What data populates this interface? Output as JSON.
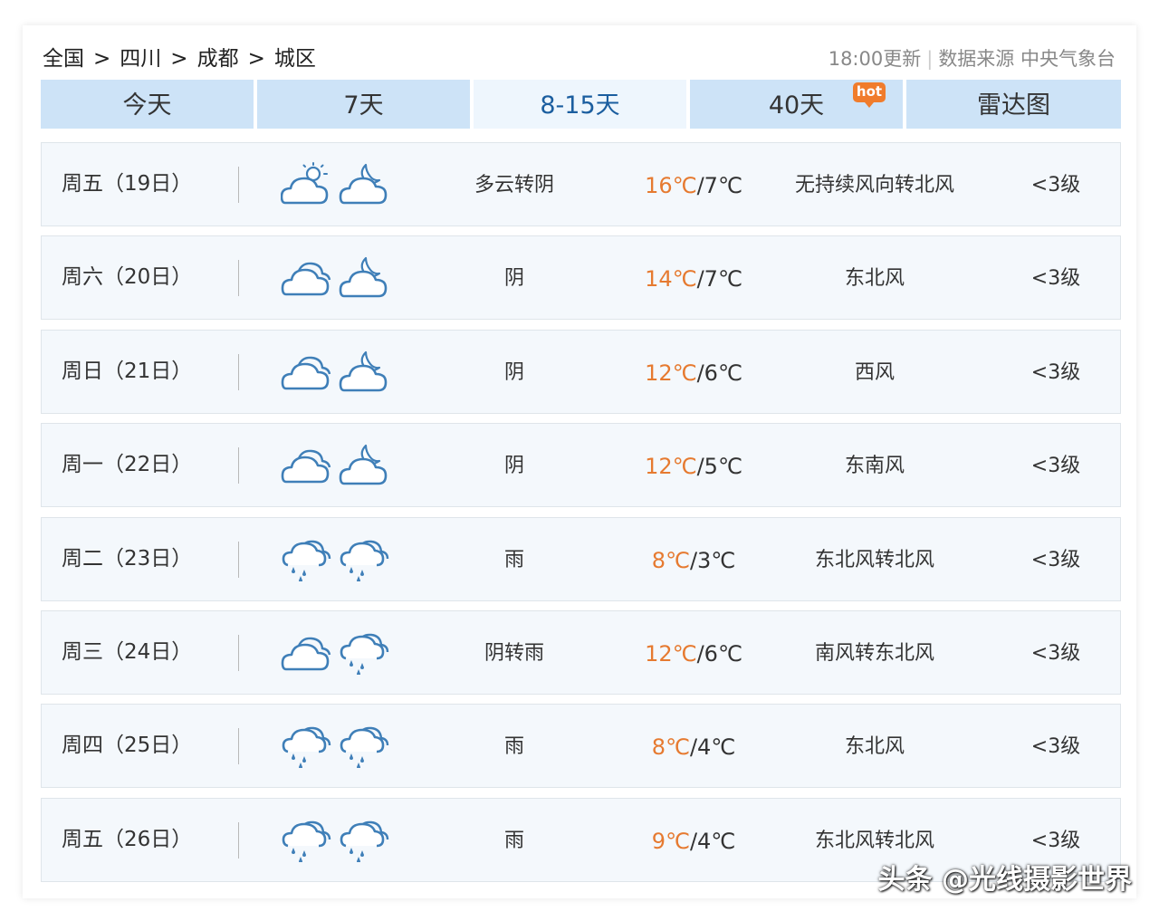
{
  "breadcrumb": [
    "全国",
    "四川",
    "成都",
    "城区"
  ],
  "breadcrumb_separator": ">",
  "update_time": "18:00更新",
  "data_source": "数据来源 中央气象台",
  "tabs": [
    {
      "label": "今天"
    },
    {
      "label": "7天"
    },
    {
      "label": "8-15天",
      "active": true
    },
    {
      "label": "40天",
      "badge": "hot"
    },
    {
      "label": "雷达图"
    }
  ],
  "forecast": [
    {
      "day": "周五（19日）",
      "icons": [
        "partly-cloudy-day-icon",
        "cloudy-night-icon"
      ],
      "weather": "多云转阴",
      "high": "16℃",
      "low": "/7℃",
      "wind": "无持续风向转北风",
      "level": "<3级"
    },
    {
      "day": "周六（20日）",
      "icons": [
        "cloudy-icon",
        "cloudy-night-icon"
      ],
      "weather": "阴",
      "high": "14℃",
      "low": "/7℃",
      "wind": "东北风",
      "level": "<3级"
    },
    {
      "day": "周日（21日）",
      "icons": [
        "cloudy-icon",
        "cloudy-night-icon"
      ],
      "weather": "阴",
      "high": "12℃",
      "low": "/6℃",
      "wind": "西风",
      "level": "<3级"
    },
    {
      "day": "周一（22日）",
      "icons": [
        "cloudy-icon",
        "cloudy-night-icon"
      ],
      "weather": "阴",
      "high": "12℃",
      "low": "/5℃",
      "wind": "东南风",
      "level": "<3级"
    },
    {
      "day": "周二（23日）",
      "icons": [
        "rain-icon",
        "rain-icon"
      ],
      "weather": "雨",
      "high": "8℃",
      "low": "/3℃",
      "wind": "东北风转北风",
      "level": "<3级"
    },
    {
      "day": "周三（24日）",
      "icons": [
        "cloudy-icon",
        "rain-icon"
      ],
      "weather": "阴转雨",
      "high": "12℃",
      "low": "/6℃",
      "wind": "南风转东北风",
      "level": "<3级"
    },
    {
      "day": "周四（25日）",
      "icons": [
        "rain-icon",
        "rain-icon"
      ],
      "weather": "雨",
      "high": "8℃",
      "low": "/4℃",
      "wind": "东北风",
      "level": "<3级"
    },
    {
      "day": "周五（26日）",
      "icons": [
        "rain-icon",
        "rain-icon"
      ],
      "weather": "雨",
      "high": "9℃",
      "low": "/4℃",
      "wind": "东北风转北风",
      "level": "<3级"
    }
  ],
  "watermark": "头条 @光线摄影世界",
  "colors": {
    "tab_bg": "#cde3f7",
    "tab_active_bg": "#eef6fd",
    "tab_active_text": "#1b5e9f",
    "high_temp": "#e67a30",
    "icon_stroke": "#3f7fb8",
    "hot_badge": "#f07c2c",
    "row_bg": "#f4f8fc"
  }
}
